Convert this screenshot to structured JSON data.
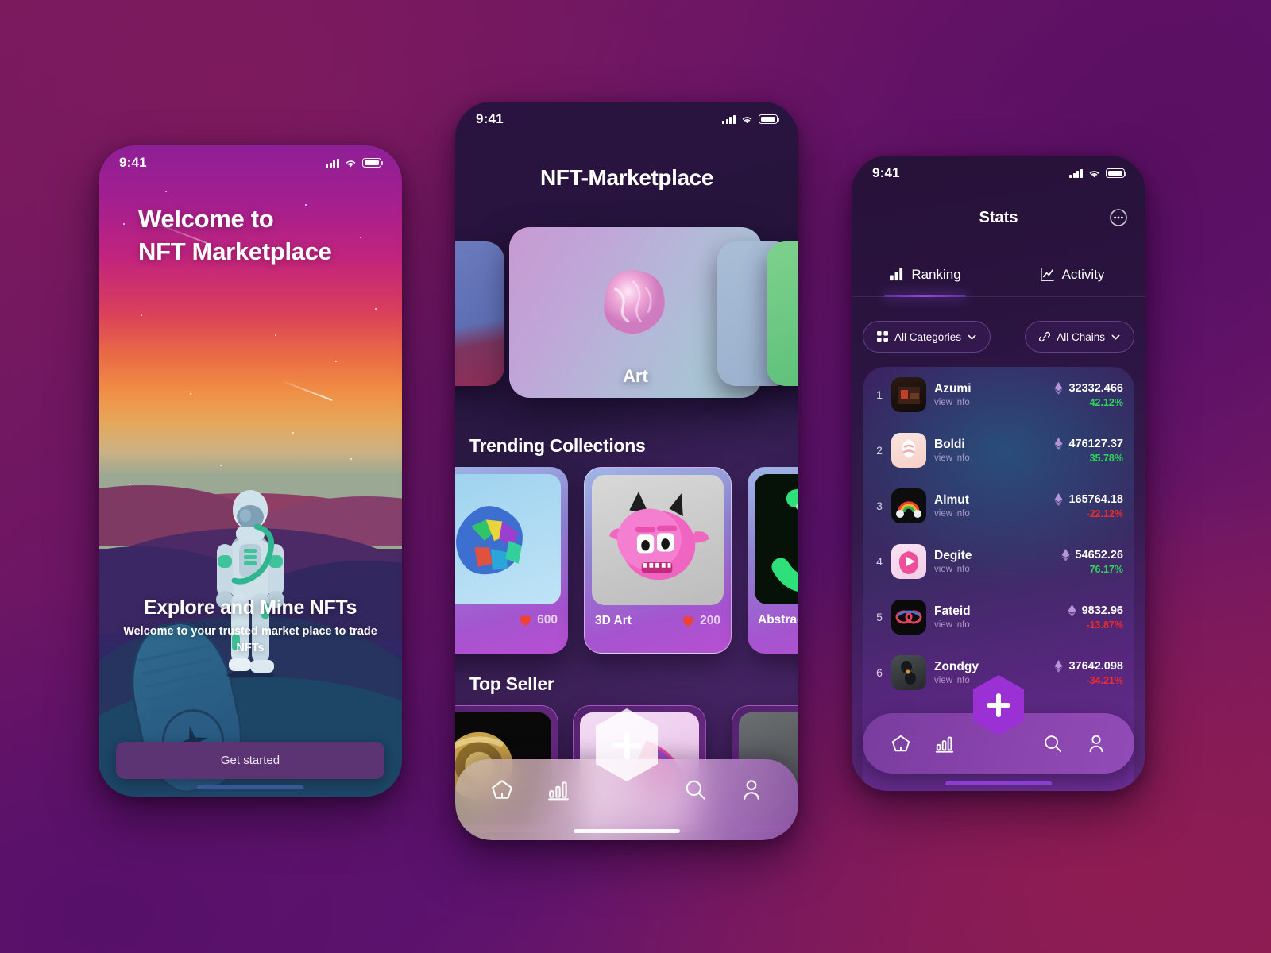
{
  "background": {
    "accent": "#7a1a5c",
    "accent2": "#5d1370"
  },
  "statusbar": {
    "time": "9:41",
    "cellular_icon": "signal-bars-icon",
    "wifi_icon": "wifi-icon",
    "battery_icon": "battery-icon"
  },
  "onboarding": {
    "headline_line1": "Welcome to",
    "headline_line2": "NFT Marketplace",
    "footer_title": "Explore and Mine NFTs",
    "footer_sub": "Welcome to your trusted market place to trade NFTs",
    "cta_label": "Get started",
    "cta_color": "#5c3473",
    "illustration": "astronaut-on-planet-illustration"
  },
  "marketplace": {
    "title": "NFT-Marketplace",
    "categories": [
      {
        "label": "",
        "name": "category-card-left"
      },
      {
        "label": "Art",
        "name": "category-card-art"
      },
      {
        "label": "",
        "name": "category-card-right"
      }
    ],
    "sections": {
      "trending": "Trending Collections",
      "top_seller": "Top Seller"
    },
    "collections": [
      {
        "name": "",
        "likes": "600",
        "thumb": "gem-heart-3d"
      },
      {
        "name": "3D Art",
        "likes": "200",
        "thumb": "pink-ghost-3d"
      },
      {
        "name": "Abstract Art",
        "likes": "",
        "thumb": "green-ribbon-3d"
      }
    ],
    "top_sellers": [
      {
        "thumb": "gold-coil-3d"
      },
      {
        "thumb": "pink-holo-3d"
      },
      {
        "thumb": "grey-object-3d"
      }
    ],
    "nav": [
      {
        "label": "Home",
        "icon": "home-icon"
      },
      {
        "label": "Stats",
        "icon": "bar-chart-icon"
      },
      {
        "label": "Add",
        "icon": "plus-icon"
      },
      {
        "label": "Search",
        "icon": "search-icon"
      },
      {
        "label": "Profile",
        "icon": "user-icon"
      }
    ]
  },
  "stats": {
    "title": "Stats",
    "more_icon": "more-circle-icon",
    "tabs": [
      {
        "label": "Ranking",
        "icon": "bar-chart-icon",
        "active": true
      },
      {
        "label": "Activity",
        "icon": "line-chart-icon",
        "active": false
      }
    ],
    "filters": [
      {
        "label": "All Categories",
        "icon": "grid-icon",
        "chevron": "chevron-down-icon"
      },
      {
        "label": "All Chains",
        "icon": "link-icon",
        "chevron": "chevron-down-icon"
      }
    ],
    "view_info_label": "view info",
    "colors": {
      "up": "#2fd65a",
      "down": "#ef2b2b",
      "eth_icon": "#b694d8"
    },
    "rows": [
      {
        "rank": "1",
        "name": "Azumi",
        "view": "view info",
        "eth": "32332.466",
        "change": "42.12%",
        "dir": "up",
        "avatar": "dark-room-3d"
      },
      {
        "rank": "2",
        "name": "Boldi",
        "view": "view info",
        "eth": "476127.37",
        "change": "35.78%",
        "dir": "up",
        "avatar": "ice-cream-swirl-3d"
      },
      {
        "rank": "3",
        "name": "Almut",
        "view": "view info",
        "eth": "165764.18",
        "change": "-22.12%",
        "dir": "down",
        "avatar": "rainbow-cloud-3d"
      },
      {
        "rank": "4",
        "name": "Degite",
        "view": "view info",
        "eth": "54652.26",
        "change": "76.17%",
        "dir": "up",
        "avatar": "pink-play-3d"
      },
      {
        "rank": "5",
        "name": "Fateid",
        "view": "view info",
        "eth": "9832.96",
        "change": "-13.87%",
        "dir": "down",
        "avatar": "red-rings-3d"
      },
      {
        "rank": "6",
        "name": "Zondgy",
        "view": "view info",
        "eth": "37642.098",
        "change": "-34.21%",
        "dir": "down",
        "avatar": "dark-earbuds-3d"
      }
    ],
    "nav": [
      {
        "label": "Home",
        "icon": "home-icon"
      },
      {
        "label": "Stats",
        "icon": "bar-chart-icon"
      },
      {
        "label": "Add",
        "icon": "plus-icon"
      },
      {
        "label": "Search",
        "icon": "search-icon"
      },
      {
        "label": "Profile",
        "icon": "user-icon"
      }
    ]
  }
}
